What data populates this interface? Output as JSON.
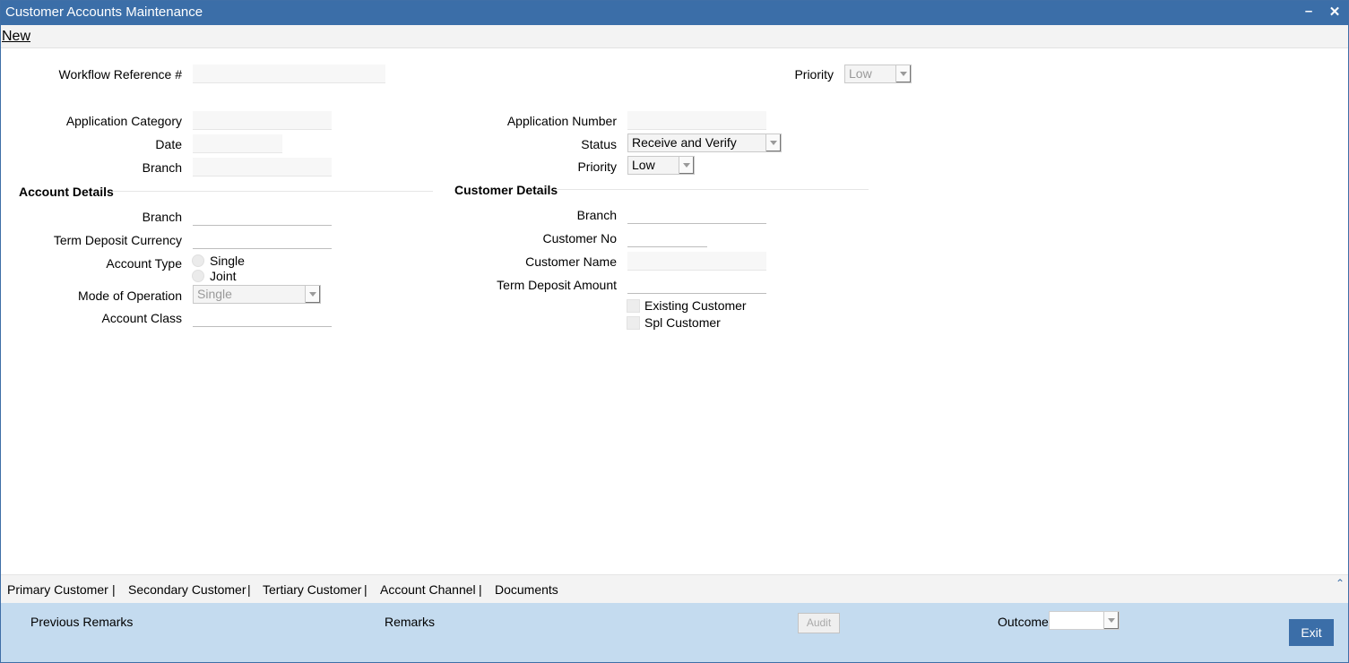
{
  "window": {
    "title": "Customer Accounts Maintenance"
  },
  "menu": {
    "new_label": "New"
  },
  "header": {
    "workflow_ref_label": "Workflow Reference #",
    "workflow_ref_value": "",
    "priority_label": "Priority",
    "priority_value": "Low"
  },
  "application": {
    "category_label": "Application Category",
    "date_label": "Date",
    "branch_label": "Branch",
    "number_label": "Application Number",
    "status_label": "Status",
    "status_value": "Receive and Verify",
    "priority_label": "Priority",
    "priority_value": "Low"
  },
  "account_details": {
    "heading": "Account Details",
    "branch_label": "Branch",
    "td_currency_label": "Term Deposit Currency",
    "account_type_label": "Account Type",
    "account_type_options": [
      "Single",
      "Joint"
    ],
    "mode_label": "Mode of Operation",
    "mode_value": "Single",
    "account_class_label": "Account Class"
  },
  "customer_details": {
    "heading": "Customer Details",
    "branch_label": "Branch",
    "customer_no_label": "Customer No",
    "customer_name_label": "Customer Name",
    "td_amount_label": "Term Deposit Amount",
    "existing_customer_label": "Existing Customer",
    "spl_customer_label": "Spl Customer"
  },
  "tabs": [
    "Primary Customer",
    "Secondary Customer",
    "Tertiary Customer",
    "Account Channel",
    "Documents"
  ],
  "tab_separator": "|",
  "footer": {
    "previous_remarks_label": "Previous Remarks",
    "remarks_label": "Remarks",
    "audit_label": "Audit",
    "outcome_label": "Outcome",
    "outcome_value": "",
    "exit_label": "Exit"
  },
  "colors": {
    "titlebar": "#3b6ea8",
    "footer": "#c4dbef",
    "exit_button": "#3b6ea8"
  }
}
